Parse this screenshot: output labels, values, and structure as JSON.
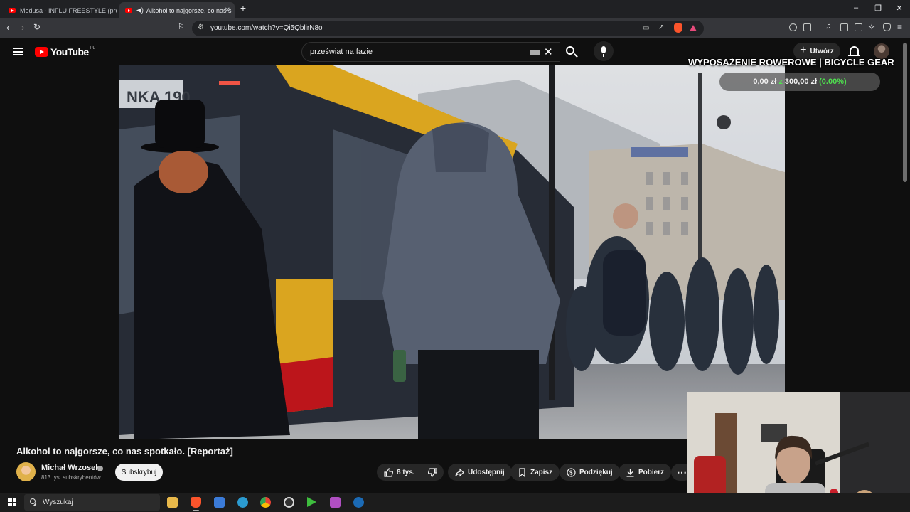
{
  "browser": {
    "tabs": [
      {
        "title": "Medusa - INFLU FREESTYLE (prod. VI",
        "active": false
      },
      {
        "title": "Alkohol to najgorsze, co nas s",
        "active": true,
        "audio_icon": "speaker-icon"
      }
    ],
    "url": "youtube.com/watch?v=Qi5QblirN8o"
  },
  "youtube": {
    "logo_text": "YouTube",
    "country_code": "PL",
    "search_query": "przeświat na fazie",
    "create_label": "Utwórz"
  },
  "overlay": {
    "goal_title": "WYPOSAŻENIE ROWEROWE | BICYCLE GEAR",
    "goal_current": "0,00 zł",
    "goal_of": "z",
    "goal_target": "300,00 zł",
    "goal_percent": "(0.00%)",
    "goal_progress": 0.0,
    "percent_color": "#4fe04f"
  },
  "video": {
    "title": "Alkohol to najgorsze, co nas spotkało. [Reportaż]",
    "channel_name": "Michał Wrzosek",
    "subscribers": "813 tys. subskrybentów",
    "subscribe_label": "Subskrybuj",
    "likes": "8 tys.",
    "share_label": "Udostępnij",
    "save_label": "Zapisz",
    "thanks_label": "Podziękuj",
    "download_label": "Pobierz",
    "bus_sign": "NKA 190"
  },
  "taskbar": {
    "search_placeholder": "Wyszukaj",
    "apps": [
      "file-explorer-icon",
      "brave-icon",
      "store-icon",
      "edge-icon",
      "chrome-icon",
      "obs-icon",
      "game-launcher-icon",
      "media-icon",
      "steam-icon"
    ]
  },
  "colors": {
    "youtube_red": "#ff0000",
    "bus_yellow": "#e8b021",
    "bus_red": "#c8171d"
  }
}
